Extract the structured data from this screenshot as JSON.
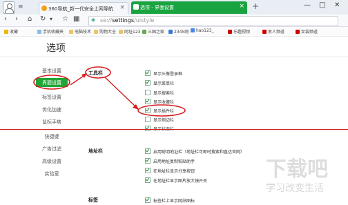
{
  "tabs": [
    {
      "label": "360导航_新一代安全上网导航"
    },
    {
      "label": "选项 - 界面设置"
    }
  ],
  "address": {
    "scheme": "se://",
    "path": "settings",
    "rest": "/uistyle"
  },
  "bookmarks": [
    "收藏",
    "手机收藏夹",
    "电脑技术",
    "购物大全",
    "网址123",
    "三国之家",
    "2345网",
    "hao123_",
    "乐趣视频",
    "男人频道",
    "女装频道"
  ],
  "page_title": "选项",
  "sidebar": [
    "基本设置",
    "界面设置",
    "标签设置",
    "优化加速",
    "鼠标手势",
    "快捷键",
    "广告过滤",
    "高级设置",
    "实验室"
  ],
  "toolbar_section": {
    "title": "工具栏",
    "options": [
      {
        "label": "显示头像登录框",
        "checked": true
      },
      {
        "label": "显示菜单栏",
        "checked": true
      },
      {
        "label": "显示搜索栏",
        "checked": false
      },
      {
        "label": "显示收藏栏",
        "checked": true
      },
      {
        "label": "显示插件栏",
        "checked": true
      },
      {
        "label": "显示侧边栏",
        "checked": false
      },
      {
        "label": "显示状态栏",
        "checked": true
      }
    ]
  },
  "address_section": {
    "title": "地址栏",
    "options": [
      {
        "label": "启用聪明地址栏（地址栏可即时搜索和直达官网）",
        "checked": true
      },
      {
        "label": "启用地址复制粘贴助手",
        "checked": true
      },
      {
        "label": "在地址栏显示分享按钮",
        "checked": true
      },
      {
        "label": "在地址栏显示图片放大镜开关",
        "checked": true
      }
    ]
  },
  "tabs_section": {
    "title": "标签",
    "options": [
      {
        "label": "标签栏上显示网站图标",
        "checked": true
      }
    ]
  },
  "watermark": {
    "main": "下载吧",
    "sub": "学习改变生活"
  },
  "colors": {
    "accent": "#22a538",
    "annotation": "#d61f1f"
  }
}
